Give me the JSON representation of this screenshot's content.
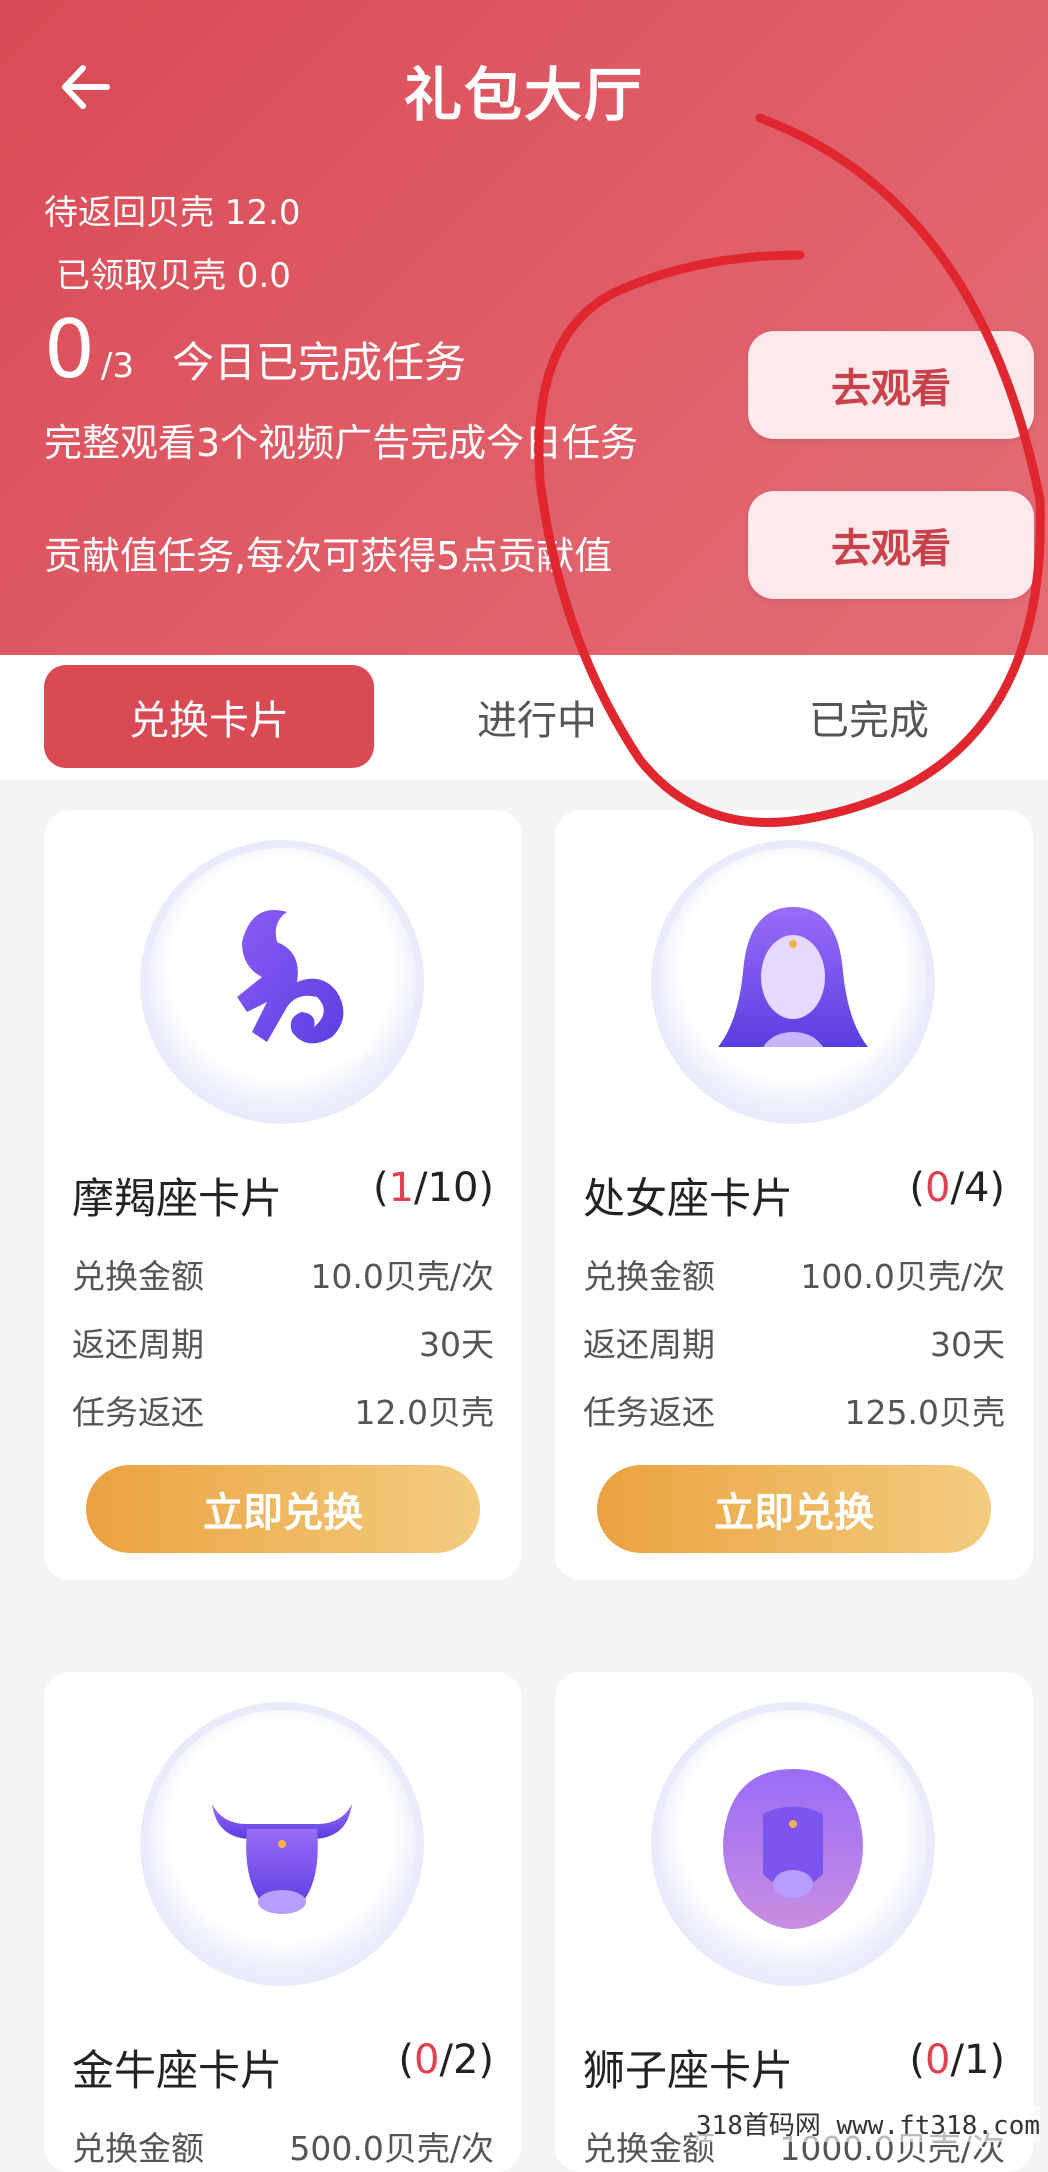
{
  "header": {
    "title": "礼包大厅",
    "pending_shells": "待返回贝壳 12.0",
    "received_shells": "已领取贝壳 0.0",
    "progress_done": "0",
    "progress_total": "/3",
    "progress_label": "今日已完成任务",
    "task_desc": "完整观看3个视频广告完成今日任务",
    "contrib_desc": "贡献值任务,每次可获得5点贡献值",
    "watch_button_1": "去观看",
    "watch_button_2": "去观看"
  },
  "tabs": [
    {
      "label": "兑换卡片",
      "active": true
    },
    {
      "label": "进行中",
      "active": false
    },
    {
      "label": "已完成",
      "active": false
    }
  ],
  "cards": [
    {
      "name": "摩羯座卡片",
      "used": "1",
      "limit": "/10)",
      "open": "(",
      "price_label": "兑换金额",
      "price": "10.0贝壳/次",
      "cycle_label": "返还周期",
      "cycle": "30天",
      "return_label": "任务返还",
      "return": "12.0贝壳",
      "button": "立即兑换",
      "icon": "capricorn-icon"
    },
    {
      "name": "处女座卡片",
      "used": "0",
      "limit": "/4)",
      "open": "(",
      "price_label": "兑换金额",
      "price": "100.0贝壳/次",
      "cycle_label": "返还周期",
      "cycle": "30天",
      "return_label": "任务返还",
      "return": "125.0贝壳",
      "button": "立即兑换",
      "icon": "virgo-icon"
    },
    {
      "name": "金牛座卡片",
      "used": "0",
      "limit": "/2)",
      "open": "(",
      "price_label": "兑换金额",
      "price": "500.0贝壳/次",
      "icon": "taurus-icon"
    },
    {
      "name": "狮子座卡片",
      "used": "0",
      "limit": "/1)",
      "open": "(",
      "price_label": "兑换金额",
      "price": "1000.0贝壳/次",
      "icon": "leo-icon"
    }
  ],
  "watermark": "318首码网 www.ft318.com",
  "colors": {
    "header": "#d94a55",
    "accent_button": "#eaa23f",
    "annotation": "#e0262e"
  }
}
